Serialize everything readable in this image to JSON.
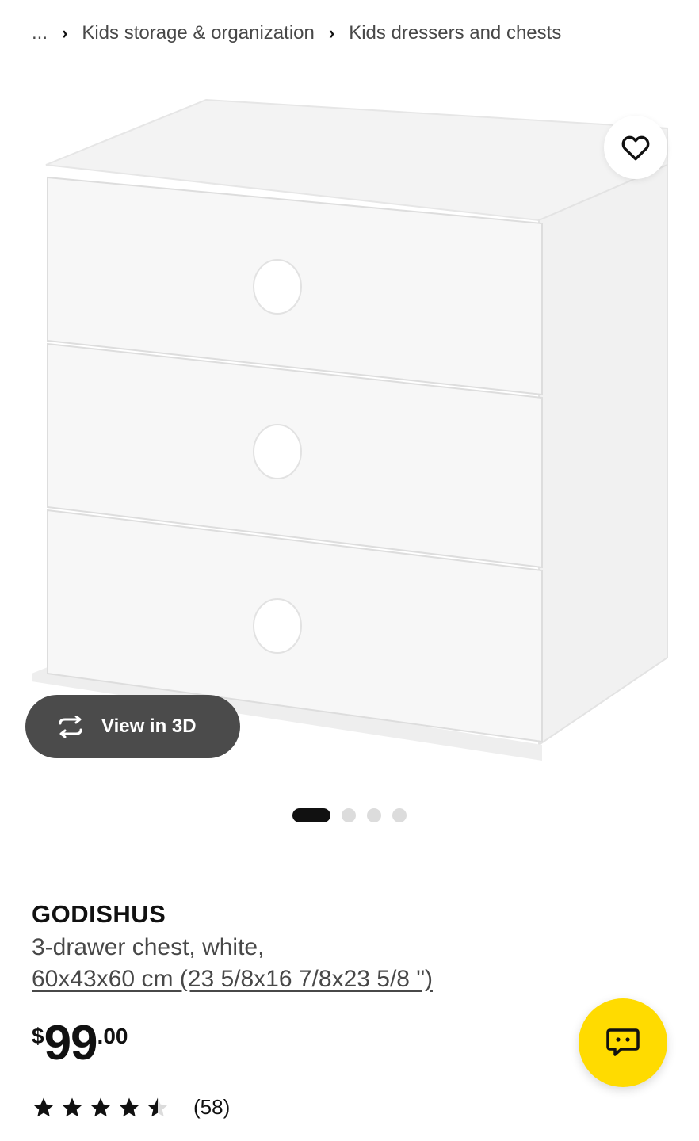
{
  "breadcrumb": {
    "ellipsis": "...",
    "items": [
      "Kids storage & organization",
      "Kids dressers and chests"
    ]
  },
  "gallery": {
    "view3d_label": "View in 3D",
    "dots_total": 4,
    "active_dot": 1
  },
  "product": {
    "name": "GODISHUS",
    "description": "3-drawer chest, white,",
    "dimensions": "60x43x60 cm (23 5/8x16 7/8x23 5/8 \")",
    "price": {
      "currency": "$",
      "integer": "99",
      "decimal": ".00"
    },
    "rating": {
      "stars": 4.5,
      "max": 5,
      "count": "(58)"
    }
  },
  "colors": {
    "accent": "#ffdb00",
    "view3d_bg": "#4b4b4b",
    "text": "#111111",
    "muted": "#484848"
  },
  "icons": [
    "heart-icon",
    "rotate-3d-icon",
    "chat-icon",
    "star-icon"
  ]
}
